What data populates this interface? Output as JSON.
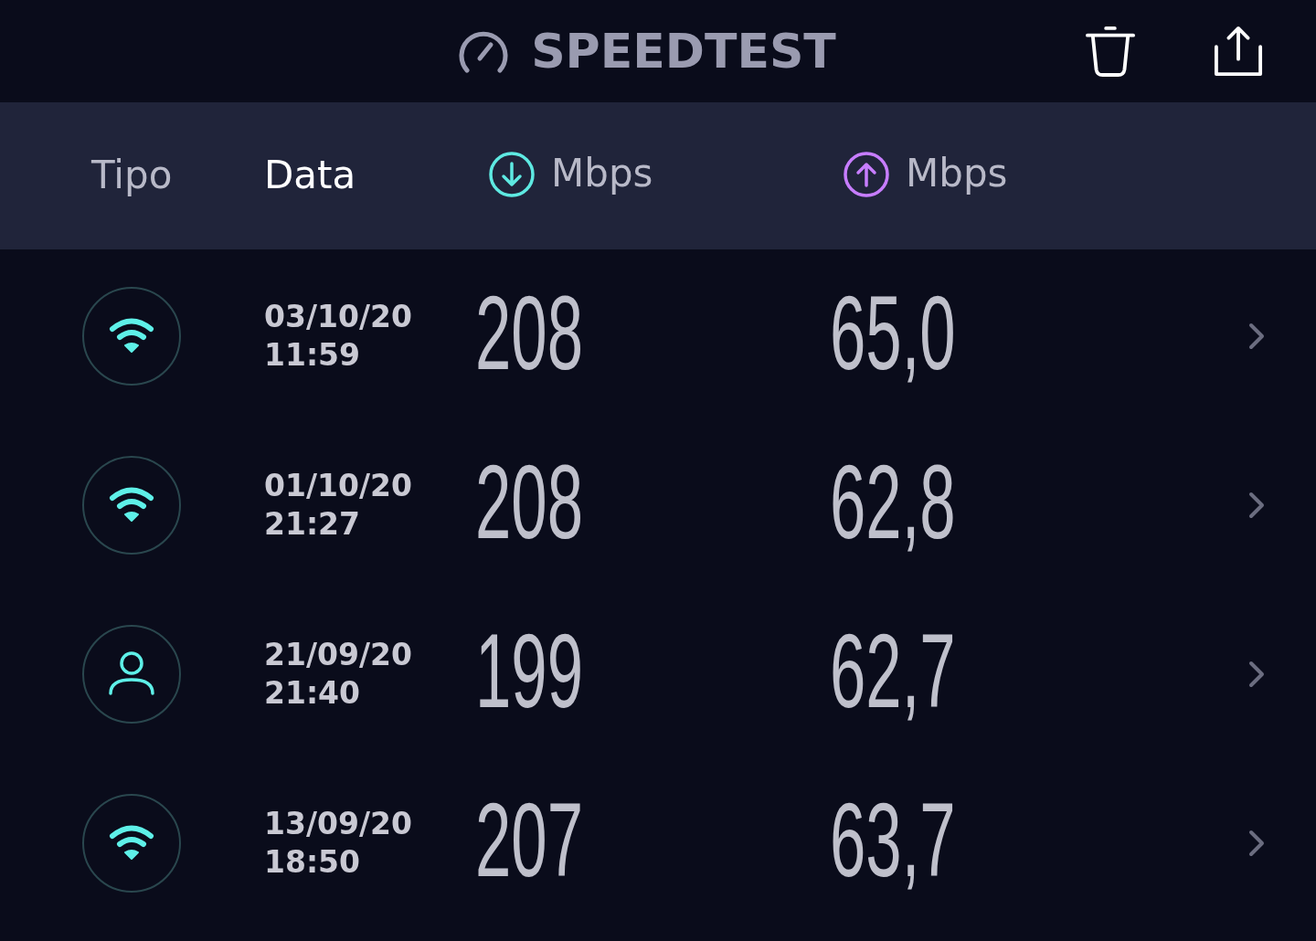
{
  "header": {
    "title": "SPEEDTEST"
  },
  "columns": [
    {
      "kind": "label",
      "label": "Tipo",
      "selected": false
    },
    {
      "kind": "label",
      "label": "Data",
      "selected": true
    },
    {
      "kind": "download",
      "label": "Mbps",
      "selected": false
    },
    {
      "kind": "upload",
      "label": "Mbps",
      "selected": false
    }
  ],
  "results": [
    {
      "kind": "wifi",
      "date": "03/10/20",
      "time": "11:59",
      "download": "208",
      "upload": "65,0"
    },
    {
      "kind": "wifi",
      "date": "01/10/20",
      "time": "21:27",
      "download": "208",
      "upload": "62,8"
    },
    {
      "kind": "person",
      "date": "21/09/20",
      "time": "21:40",
      "download": "199",
      "upload": "62,7"
    },
    {
      "kind": "wifi",
      "date": "13/09/20",
      "time": "18:50",
      "download": "207",
      "upload": "63,7"
    }
  ]
}
